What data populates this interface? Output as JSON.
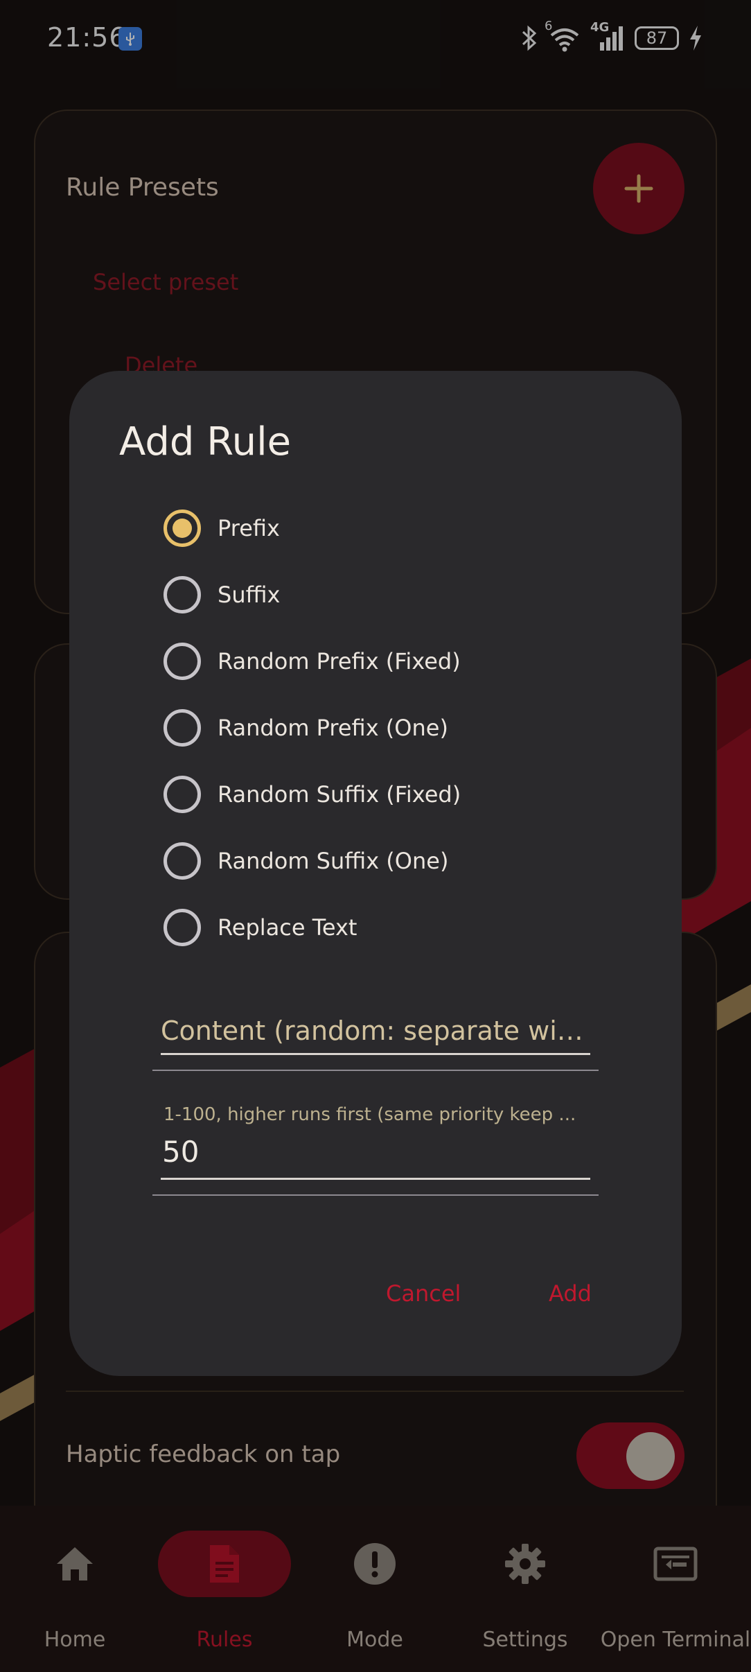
{
  "status_bar": {
    "time": "21:56",
    "network": "4G",
    "wifi_badge": "6",
    "battery": "87"
  },
  "background": {
    "presets_title": "Rule Presets",
    "select_preset": "Select preset",
    "delete_label": "Delete",
    "haptic_label": "Haptic feedback on tap",
    "haptic_enabled": true
  },
  "dialog": {
    "title": "Add Rule",
    "options": [
      {
        "label": "Prefix",
        "checked": true
      },
      {
        "label": "Suffix",
        "checked": false
      },
      {
        "label": "Random Prefix (Fixed)",
        "checked": false
      },
      {
        "label": "Random Prefix (One)",
        "checked": false
      },
      {
        "label": "Random Suffix (Fixed)",
        "checked": false
      },
      {
        "label": "Random Suffix (One)",
        "checked": false
      },
      {
        "label": "Replace Text",
        "checked": false
      }
    ],
    "content_placeholder": "Content (random: separate with |, ...",
    "priority_hint": "1-100, higher runs first (same priority keep ...",
    "priority_value": "50",
    "cancel_label": "Cancel",
    "add_label": "Add"
  },
  "nav": {
    "items": [
      {
        "label": "Home",
        "icon": "home-icon",
        "active": false
      },
      {
        "label": "Rules",
        "icon": "document-icon",
        "active": true
      },
      {
        "label": "Mode",
        "icon": "alert-icon",
        "active": false
      },
      {
        "label": "Settings",
        "icon": "gear-icon",
        "active": false
      },
      {
        "label": "Open Terminal",
        "icon": "terminal-icon",
        "active": false
      }
    ]
  },
  "colors": {
    "accent_red": "#c0182e",
    "radio_checked": "#e8c06a",
    "dialog_bg": "#2a292c"
  }
}
